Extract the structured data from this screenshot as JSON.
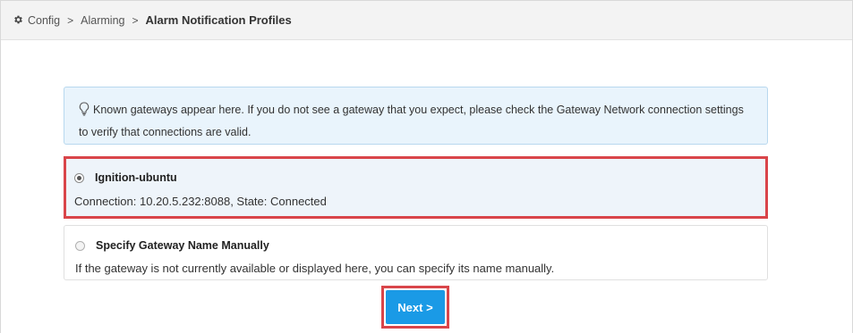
{
  "breadcrumb": {
    "icon": "gear-icon",
    "items": [
      "Config",
      "Alarming",
      "Alarm Notification Profiles"
    ],
    "separator": ">"
  },
  "info": {
    "icon": "lightbulb-icon",
    "text": "Known gateways appear here. If you do not see a gateway that you expect, please check the Gateway Network connection settings to verify that connections are valid."
  },
  "options": [
    {
      "title": "Ignition-ubuntu",
      "description": "Connection: 10.20.5.232:8088, State: Connected",
      "selected": true
    },
    {
      "title": "Specify Gateway Name Manually",
      "description": "If the gateway is not currently available or displayed here, you can specify its name manually.",
      "selected": false
    }
  ],
  "next_button": {
    "label": "Next >"
  },
  "colors": {
    "accent": "#1a9ae6",
    "highlight": "#d9454a",
    "info_bg": "#e9f4fc"
  }
}
